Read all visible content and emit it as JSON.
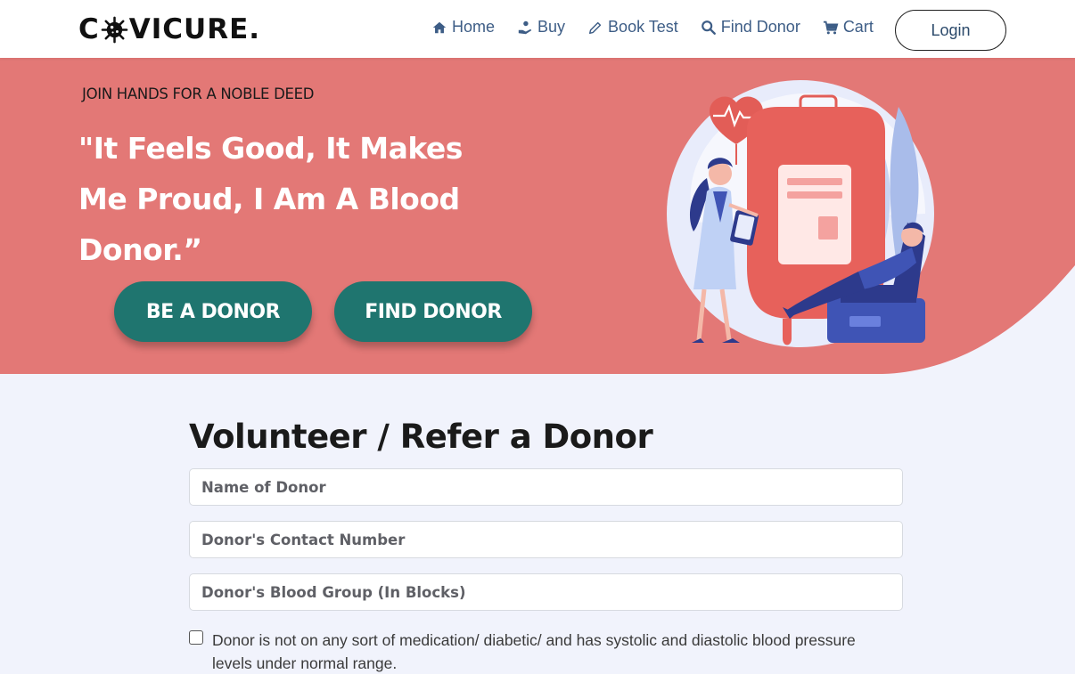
{
  "brand": {
    "logo_prefix": "C",
    "logo_suffix": "VICURE.",
    "logo_icon": "virus-icon"
  },
  "nav": {
    "items": [
      {
        "label": "Home",
        "icon": "home-icon"
      },
      {
        "label": "Buy",
        "icon": "hand-coin-icon"
      },
      {
        "label": "Book Test",
        "icon": "pencil-icon"
      },
      {
        "label": "Find Donor",
        "icon": "search-icon"
      },
      {
        "label": "Cart",
        "icon": "cart-icon"
      }
    ],
    "login_label": "Login"
  },
  "hero": {
    "tagline": "JOIN HANDS FOR A NOBLE DEED",
    "quote_line1": "\"It Feels Good, It Makes",
    "quote_line2": "Me Proud, I Am A Blood",
    "quote_line3": "Donor.”",
    "btn_donor": "BE A DONOR",
    "btn_find": "FIND DONOR"
  },
  "form": {
    "title": "Volunteer / Refer a Donor",
    "name_placeholder": "Name of Donor",
    "contact_placeholder": "Donor's Contact Number",
    "blood_placeholder": "Donor's Blood Group (In Blocks)",
    "checkbox_label": "Donor is not on any sort of medication/ diabetic/ and has systolic and diastolic blood pressure levels under normal range."
  },
  "colors": {
    "hero_bg": "#e37876",
    "button_teal": "#1f756f",
    "nav_text": "#3d5d86",
    "page_bg": "#f1f3fc"
  }
}
